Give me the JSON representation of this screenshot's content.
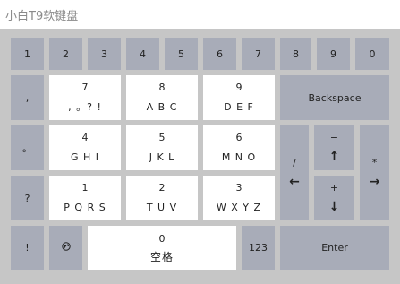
{
  "window": {
    "title": "小白T9软键盘"
  },
  "keyboard": {
    "numbers": [
      "1",
      "2",
      "3",
      "4",
      "5",
      "6",
      "7",
      "8",
      "9",
      "0"
    ],
    "punct": {
      "comma": ",",
      "period": "。",
      "question": "?",
      "exclaim": "!"
    },
    "keys": {
      "k7": {
        "digit": "7",
        "letters": ", 。? !"
      },
      "k8": {
        "digit": "8",
        "letters": "A B C"
      },
      "k9": {
        "digit": "9",
        "letters": "D E F"
      },
      "k4": {
        "digit": "4",
        "letters": "G H I"
      },
      "k5": {
        "digit": "5",
        "letters": "J K L"
      },
      "k6": {
        "digit": "6",
        "letters": "M N O"
      },
      "k1": {
        "digit": "1",
        "letters": "P Q R S"
      },
      "k2": {
        "digit": "2",
        "letters": "T U V"
      },
      "k3": {
        "digit": "3",
        "letters": "W X Y Z"
      },
      "k0": {
        "digit": "0",
        "letters": "空格"
      }
    },
    "backspace": "Backspace",
    "slash": "/",
    "minus": "−",
    "plus": "+",
    "asterisk": "*",
    "arrows": {
      "left": "←",
      "up": "↑",
      "down": "↓",
      "right": "→"
    },
    "mode123": "123",
    "enter": "Enter",
    "icons": {
      "globe": "globe-icon"
    }
  },
  "colors": {
    "board": "#c6c6c6",
    "key": "#a8acb8",
    "keyWhite": "#ffffff"
  }
}
